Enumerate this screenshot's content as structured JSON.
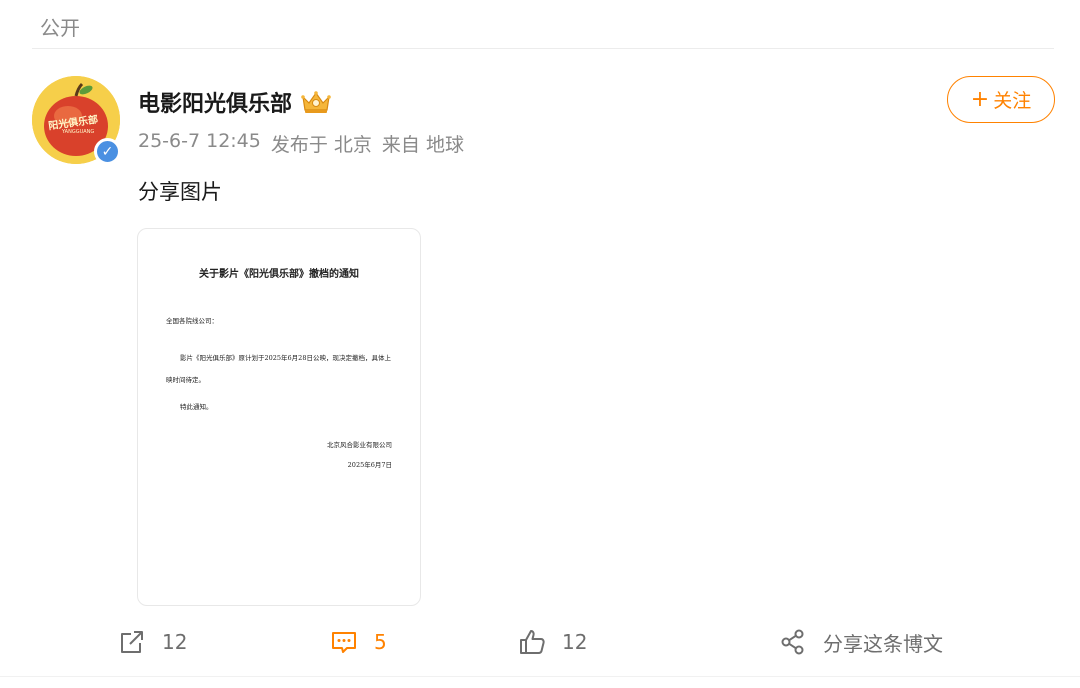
{
  "header": {
    "visibility_label": "公开"
  },
  "author": {
    "name": "电影阳光俱乐部",
    "avatar_text": "阳光俱乐部",
    "avatar_subtext": "YANGGUANG",
    "verified": true,
    "badge_icon": "crown-badge-icon"
  },
  "meta": {
    "time": "25-6-7 12:45",
    "location": "发布于 北京",
    "source": "来自 地球"
  },
  "follow_button": {
    "label": "关注",
    "icon": "+"
  },
  "post": {
    "text": "分享图片",
    "image_doc": {
      "title": "关于影片《阳光俱乐部》撤档的通知",
      "greeting": "全国各院线公司：",
      "body": "影片《阳光俱乐部》原计划于2025年6月28日公映，现决定撤档，具体上映时间待定。",
      "closing": "特此通知。",
      "company": "北京风合影业有限公司",
      "date": "2025年6月7日"
    }
  },
  "actions": {
    "repost_count": "12",
    "comment_count": "5",
    "like_count": "12",
    "share_label": "分享这条博文"
  },
  "colors": {
    "accent": "#ff8200",
    "muted": "#8a8a8a",
    "verified": "#4a90e2"
  }
}
